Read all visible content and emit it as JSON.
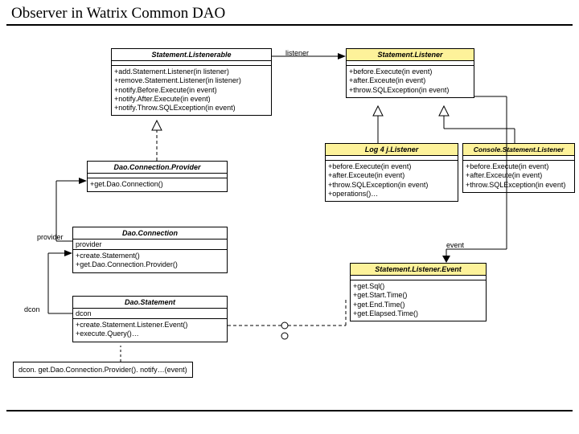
{
  "page_title": "Observer in Watrix Common DAO",
  "labels": {
    "listener": "listener",
    "provider": "provider",
    "dcon": "dcon",
    "event": "event"
  },
  "classes": {
    "listenerable": {
      "name": "Statement.Listenerable",
      "ops": [
        "+add.Statement.Listener(in listener)",
        "+remove.Statement.Listener(in listener)",
        "+notify.Before.Execute(in event)",
        "+notify.After.Execute(in event)",
        "+notify.Throw.SQLException(in event)"
      ]
    },
    "stmtListener": {
      "name": "Statement.Listener",
      "ops": [
        "+before.Execute(in event)",
        "+after.Exceute(in event)",
        "+throw.SQLException(in event)"
      ]
    },
    "log4j": {
      "name": "Log 4 j.Listener",
      "ops": [
        "+before.Execute(in event)",
        "+after.Exceute(in event)",
        "+throw.SQLException(in event)",
        "+operations()…"
      ]
    },
    "console": {
      "name": "Console.Statement.Listener",
      "ops": [
        "+before.Execute(in event)",
        "+after.Exceute(in event)",
        "+throw.SQLException(in event)"
      ]
    },
    "connProvider": {
      "name": "Dao.Connection.Provider",
      "ops": [
        "+get.Dao.Connection()"
      ]
    },
    "daoConn": {
      "name": "Dao.Connection",
      "ops": [
        "+create.Statement()",
        "+get.Dao.Connection.Provider()"
      ]
    },
    "daoStmt": {
      "name": "Dao.Statement",
      "ops": [
        "+create.Statement.Listener.Event()",
        "+execute.Query()…"
      ]
    },
    "stmtEvent": {
      "name": "Statement.Listener.Event",
      "ops": [
        "+get.Sql()",
        "+get.Start.Time()",
        "+get.End.Time()",
        "+get.Elapsed.Time()"
      ]
    }
  },
  "note": "dcon. get.Dao.Connection.Provider(). notify…(event)"
}
